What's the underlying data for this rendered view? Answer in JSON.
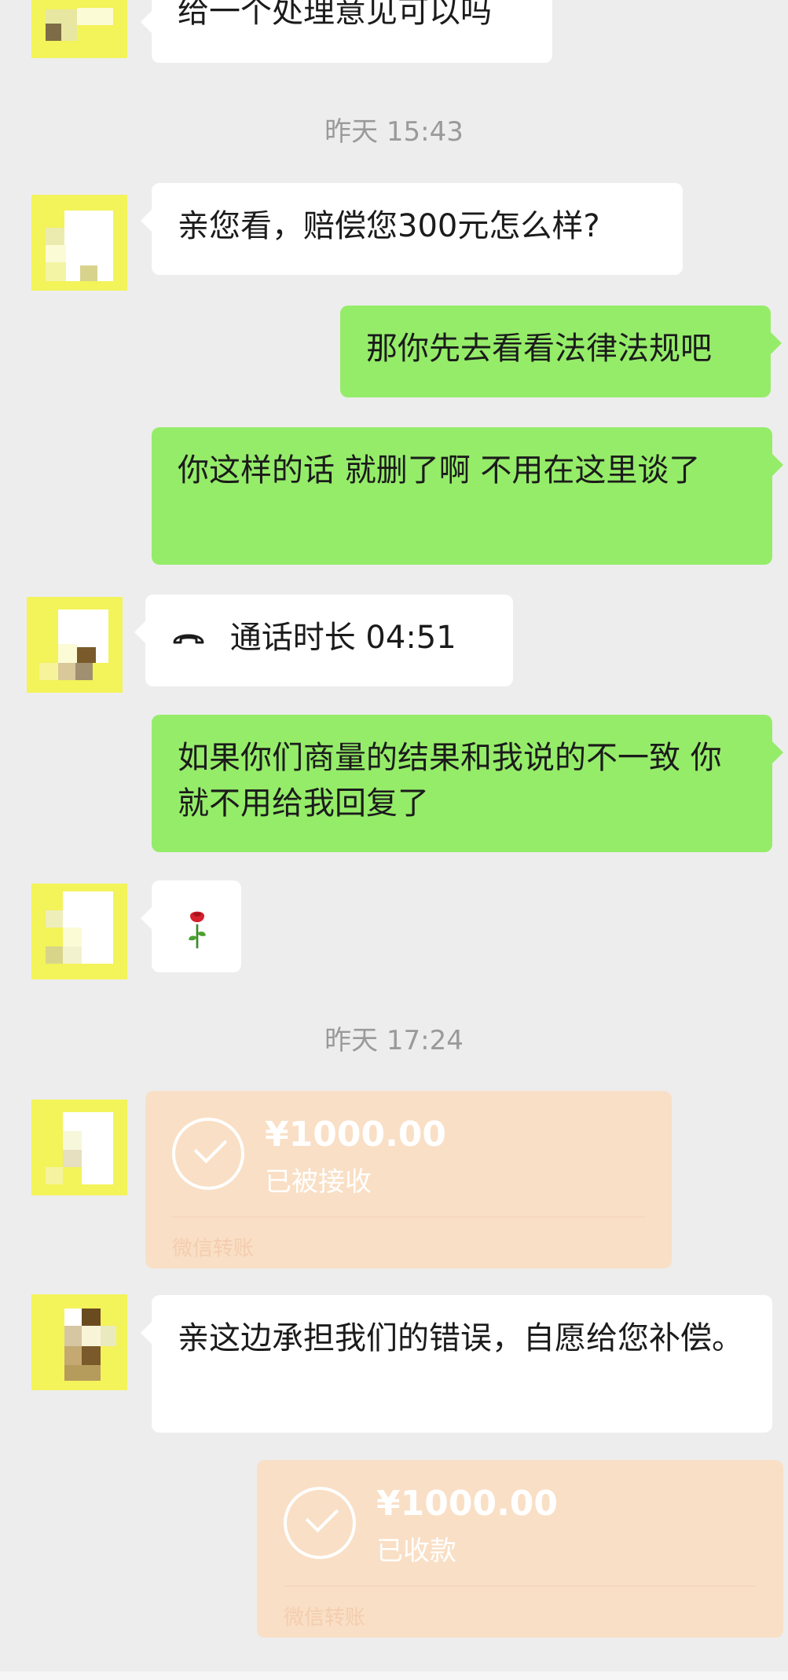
{
  "messages": {
    "m1": "给一个处理意见可以吗",
    "t1": "昨天 15:43",
    "m2": "亲您看，赔偿您300元怎么样?",
    "m3": "那你先去看看法律法规吧",
    "m4": "你这样的话 就删了啊 不用在这里谈了",
    "call_label": "通话时长 04:51",
    "m5": "如果你们商量的结果和我说的不一致 你就不用给我回复了",
    "m6_icon": "rose-emoji",
    "t2": "昨天 17:24",
    "transfer1": {
      "amount": "¥1000.00",
      "status": "已被接收",
      "footer": "微信转账"
    },
    "m7": "亲这边承担我们的错误，自愿给您补偿。",
    "transfer2": {
      "amount": "¥1000.00",
      "status": "已收款",
      "footer": "微信转账"
    }
  },
  "icons": {
    "call": "phone-hangup-icon",
    "check": "check-circle-icon"
  },
  "colors": {
    "background": "#ededed",
    "bubble_self": "#95ec69",
    "bubble_other": "#ffffff",
    "transfer": "#f9dfc5"
  }
}
